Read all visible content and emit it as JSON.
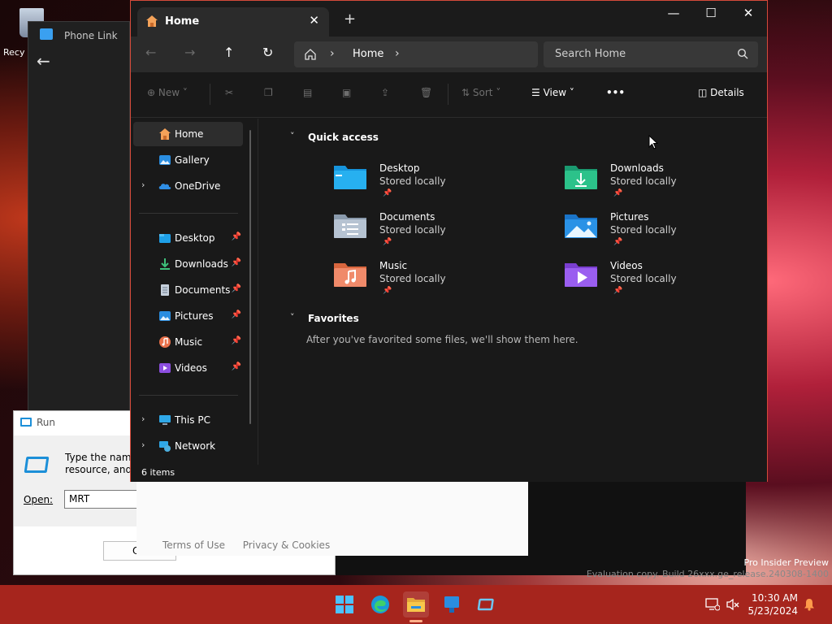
{
  "desktop": {
    "recycle_label": "Recy"
  },
  "phone_link": {
    "title": "Phone Link",
    "footer_links": [
      "Terms of Use",
      "Privacy & Cookies"
    ]
  },
  "run_dialog": {
    "title": "Run",
    "desc_line1": "Type the name",
    "desc_line2": "resource, and W",
    "open_label": "Open:",
    "open_value": "MRT",
    "ok_label": "O"
  },
  "watermark": {
    "line1": "Pro Insider Preview",
    "line2": "Evaluation copy. Build 26xxx.ge_release.240308-1400"
  },
  "explorer": {
    "tab_title": "Home",
    "window_controls": {
      "minimize": "—",
      "maximize": "☐",
      "close": "✕"
    },
    "address": {
      "crumb": "Home"
    },
    "search": {
      "placeholder": "Search Home"
    },
    "toolbar": {
      "new_label": "New",
      "sort_label": "Sort",
      "view_label": "View",
      "more_label": "•••",
      "details_label": "Details"
    },
    "sidebar": {
      "top": [
        {
          "label": "Home",
          "selected": true
        },
        {
          "label": "Gallery"
        },
        {
          "label": "OneDrive",
          "expand": true
        }
      ],
      "pinned": [
        {
          "label": "Desktop"
        },
        {
          "label": "Downloads"
        },
        {
          "label": "Documents"
        },
        {
          "label": "Pictures"
        },
        {
          "label": "Music"
        },
        {
          "label": "Videos"
        }
      ],
      "bottom": [
        {
          "label": "This PC"
        },
        {
          "label": "Network"
        }
      ]
    },
    "main": {
      "quick_access_title": "Quick access",
      "tiles": [
        {
          "name": "Desktop",
          "sub": "Stored locally"
        },
        {
          "name": "Downloads",
          "sub": "Stored locally"
        },
        {
          "name": "Documents",
          "sub": "Stored locally"
        },
        {
          "name": "Pictures",
          "sub": "Stored locally"
        },
        {
          "name": "Music",
          "sub": "Stored locally"
        },
        {
          "name": "Videos",
          "sub": "Stored locally"
        }
      ],
      "favorites_title": "Favorites",
      "favorites_empty": "After you've favorited some files, we'll show them here."
    },
    "status": {
      "items": "6 items"
    }
  },
  "taskbar": {
    "time": "10:30 AM",
    "date": "5/23/2024"
  },
  "colors": {
    "taskbar": "#a6251d",
    "explorer_bg": "#191919",
    "explorer_border": "#d44a3a",
    "folder_blue": "#1ea0e8"
  }
}
